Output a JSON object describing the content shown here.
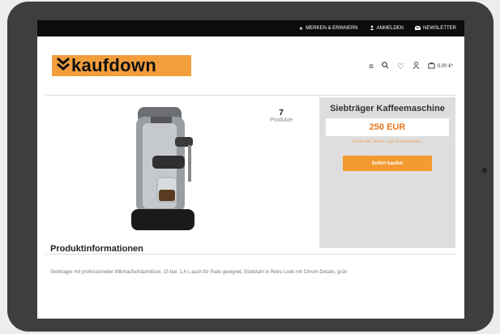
{
  "topbar": {
    "items": [
      {
        "label": "MERKEN & ERINNERN",
        "icon": "star-icon"
      },
      {
        "label": "ANMELDEN",
        "icon": "user-icon"
      },
      {
        "label": "NEWSLETTER",
        "icon": "mail-icon"
      }
    ]
  },
  "header": {
    "logo_text": "kaufdown",
    "logo_color": "#f29e3d",
    "icons": [
      "menu-icon",
      "search-icon",
      "heart-icon",
      "account-icon",
      "cart-icon"
    ],
    "cart_amount": "0,00 €*"
  },
  "product": {
    "count": "7",
    "count_label": "Produkte",
    "title": "Siebträger Kaffeemaschine",
    "price": "250 EUR",
    "note": "Preise inkl. MwSt. zzgl. Versandkosten",
    "buy_label": "Sofort kaufen",
    "accent_color": "#f39a31"
  },
  "info": {
    "heading": "Produktinformationen",
    "description": "Siebträger mit professioneller Milchaufschäumdüse, 15 bar, 1,4 l, auch für Pads geeignet, Edelstahl in Retro Look mit Chrom-Details, grün"
  }
}
